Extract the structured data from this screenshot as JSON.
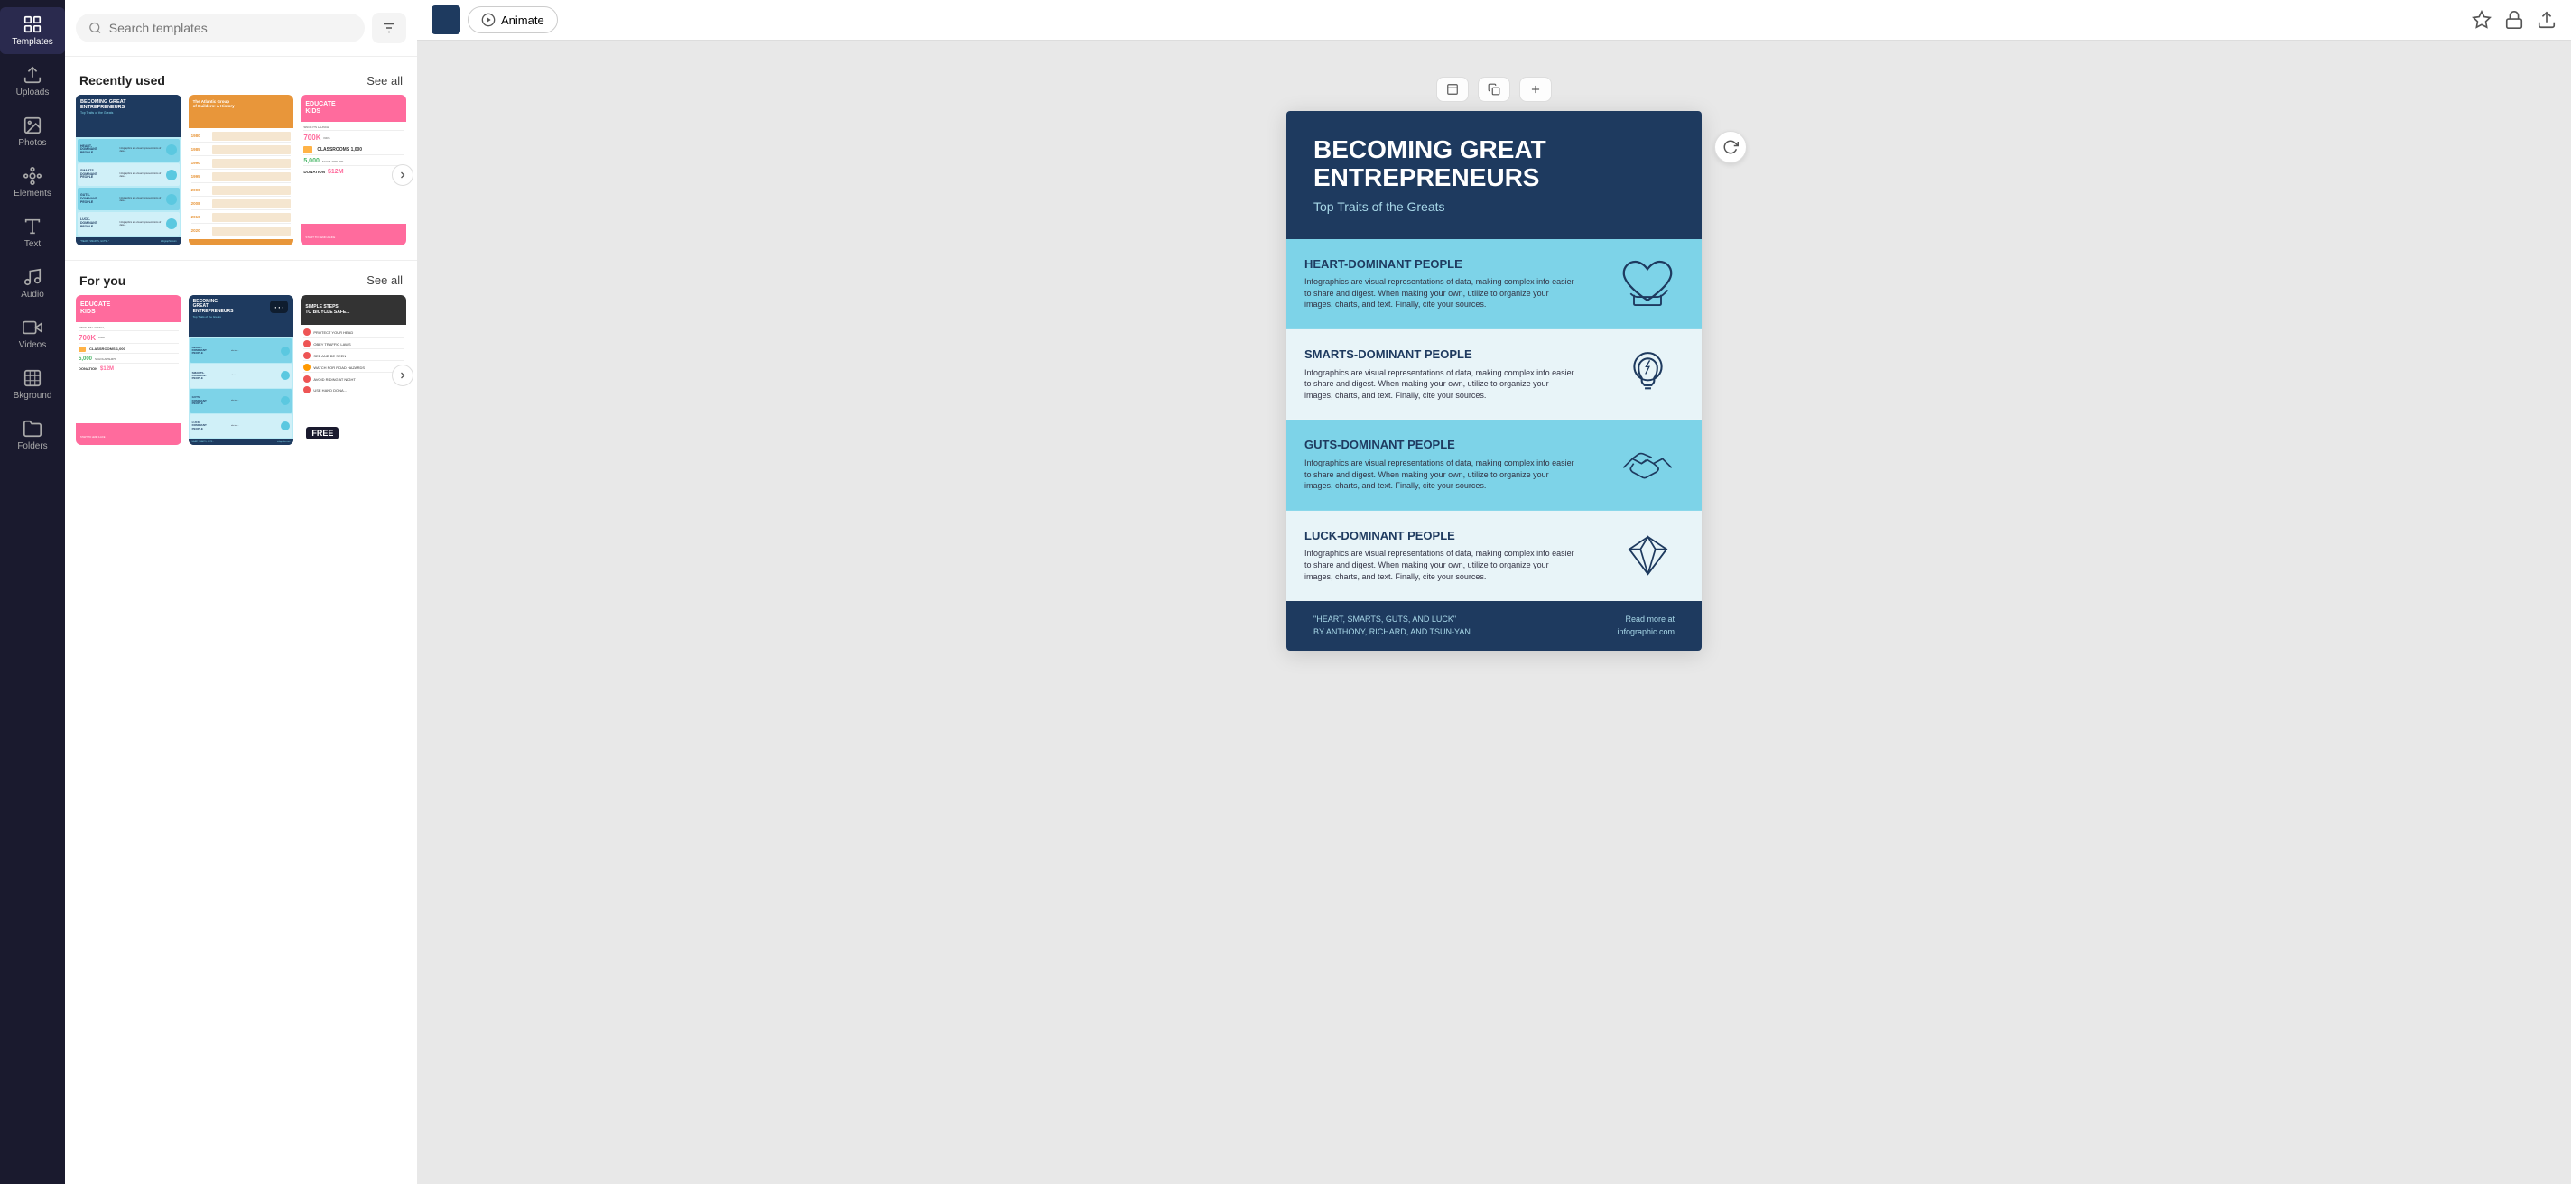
{
  "sidebar": {
    "items": [
      {
        "id": "templates",
        "label": "Templates",
        "icon": "grid"
      },
      {
        "id": "uploads",
        "label": "Uploads",
        "icon": "upload"
      },
      {
        "id": "photos",
        "label": "Photos",
        "icon": "image"
      },
      {
        "id": "elements",
        "label": "Elements",
        "icon": "elements"
      },
      {
        "id": "text",
        "label": "Text",
        "icon": "text"
      },
      {
        "id": "audio",
        "label": "Audio",
        "icon": "audio"
      },
      {
        "id": "videos",
        "label": "Videos",
        "icon": "video"
      },
      {
        "id": "bkground",
        "label": "Bkground",
        "icon": "background"
      },
      {
        "id": "folders",
        "label": "Folders",
        "icon": "folder"
      }
    ]
  },
  "search": {
    "placeholder": "Search templates"
  },
  "recently_used": {
    "label": "Recently used",
    "see_all": "See all"
  },
  "for_you": {
    "label": "For you",
    "see_all": "See all"
  },
  "toolbar": {
    "animate_label": "Animate",
    "animate_icon": "⚙",
    "top_right": [
      "design-tool",
      "lock",
      "crop"
    ]
  },
  "canvas_tools": [
    {
      "id": "new-page",
      "icon": "page"
    },
    {
      "id": "duplicate-page",
      "icon": "copy"
    },
    {
      "id": "add-page",
      "icon": "plus"
    }
  ],
  "infographic": {
    "header": {
      "title": "BECOMING GREAT ENTREPRENEURS",
      "subtitle": "Top Traits of the Greats"
    },
    "sections": [
      {
        "id": "heart",
        "title": "HEART-DOMINANT PEOPLE",
        "text": "Infographics are visual representations of data, making complex info easier to share and digest. When making your own, utilize to organize your images, charts, and text. Finally, cite your sources.",
        "icon": "heart-hand"
      },
      {
        "id": "smarts",
        "title": "SMARTS-DOMINANT PEOPLE",
        "text": "Infographics are visual representations of data, making complex info easier to share and digest. When making your own, utilize to organize your images, charts, and text. Finally, cite your sources.",
        "icon": "lightbulb"
      },
      {
        "id": "guts",
        "title": "GUTS-DOMINANT PEOPLE",
        "text": "Infographics are visual representations of data, making complex info easier to share and digest. When making your own, utilize to organize your images, charts, and text. Finally, cite your sources.",
        "icon": "handshake"
      },
      {
        "id": "luck",
        "title": "LUCK-DOMINANT PEOPLE",
        "text": "Infographics are visual representations of data, making complex info easier to share and digest. When making your own, utilize to organize your images, charts, and text. Finally, cite your sources.",
        "icon": "diamond"
      }
    ],
    "footer": {
      "quote": "\"HEART, SMARTS, GUTS, AND LUCK\"\nBY ANTHONY, RICHARD, AND TSUN-YAN",
      "link": "Read more at\ninfographic.com"
    }
  },
  "colors": {
    "navy": "#1e3a5f",
    "light_blue": "#7dd3e8",
    "pale_blue": "#e8f4f8",
    "accent_blue": "#a8d8e8",
    "sidebar_bg": "#1a1a2e"
  }
}
